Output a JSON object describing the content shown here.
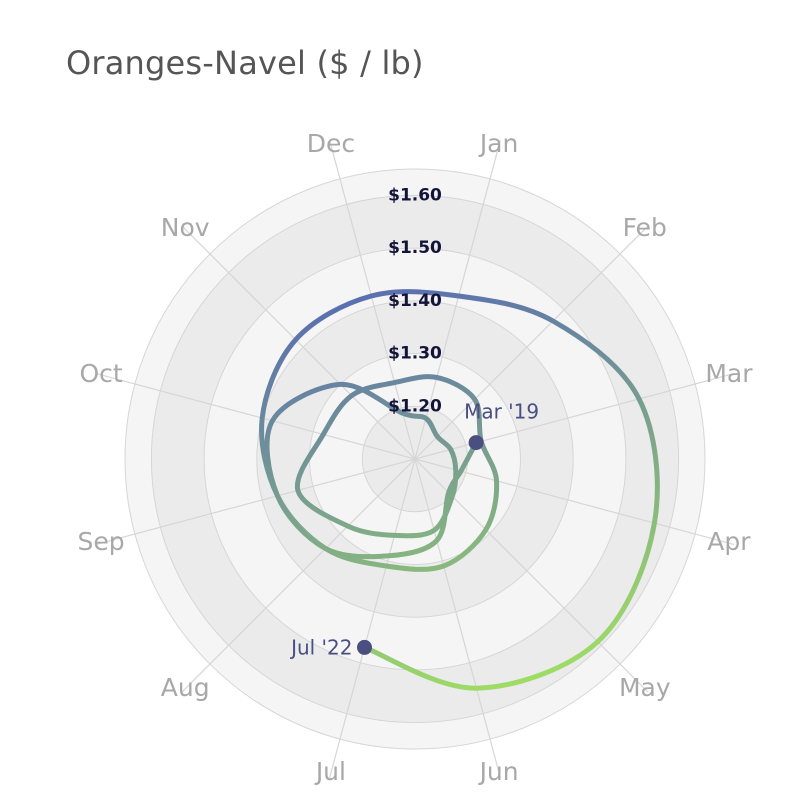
{
  "chart_title": "Oranges-Navel ($ / lb)",
  "chart_data": {
    "type": "line",
    "subtype": "polar-spiral",
    "title": "Oranges-Navel ($ / lb)",
    "months": [
      "Jan",
      "Feb",
      "Mar",
      "Apr",
      "May",
      "Jun",
      "Jul",
      "Aug",
      "Sep",
      "Oct",
      "Nov",
      "Dec"
    ],
    "radial_ticks": [
      "$1.20",
      "$1.30",
      "$1.40",
      "$1.50",
      "$1.60"
    ],
    "radial_tick_values": [
      1.2,
      1.3,
      1.4,
      1.5,
      1.6
    ],
    "rlim": [
      1.1,
      1.65
    ],
    "start_label": "Mar '19",
    "end_label": "Jul '22",
    "colors": {
      "start": "#4b1e86",
      "mid1": "#4a55c0",
      "mid2": "#3d8dc4",
      "mid3": "#46bfa0",
      "end": "#a6e85e",
      "marker": "#4a4e80",
      "grid": "#d6d6d6",
      "band_light": "#f5f5f5",
      "band_dark": "#ebebeb"
    },
    "series": [
      {
        "dates": [
          "2019-03",
          "2019-04",
          "2019-05",
          "2019-06",
          "2019-07",
          "2019-08",
          "2019-09",
          "2019-10",
          "2019-11",
          "2019-12",
          "2020-01",
          "2020-02",
          "2020-03",
          "2020-04",
          "2020-05",
          "2020-06",
          "2020-07",
          "2020-08",
          "2020-09",
          "2020-10",
          "2020-11",
          "2020-12",
          "2021-01",
          "2021-02",
          "2021-03",
          "2021-04",
          "2021-05",
          "2021-06",
          "2021-07",
          "2021-08",
          "2021-09",
          "2021-10",
          "2021-11",
          "2021-12",
          "2022-01",
          "2022-02",
          "2022-03",
          "2022-04",
          "2022-05",
          "2022-06",
          "2022-07"
        ],
        "values": [
          1.22,
          1.19,
          1.19,
          1.26,
          1.29,
          1.34,
          1.37,
          1.38,
          1.3,
          1.19,
          1.18,
          1.16,
          1.17,
          1.18,
          1.2,
          1.24,
          1.25,
          1.28,
          1.33,
          1.28,
          1.27,
          1.25,
          1.26,
          1.26,
          1.23,
          1.26,
          1.29,
          1.31,
          1.31,
          1.34,
          1.37,
          1.4,
          1.42,
          1.42,
          1.42,
          1.47,
          1.54,
          1.57,
          1.59,
          1.55,
          1.47
        ]
      }
    ]
  }
}
